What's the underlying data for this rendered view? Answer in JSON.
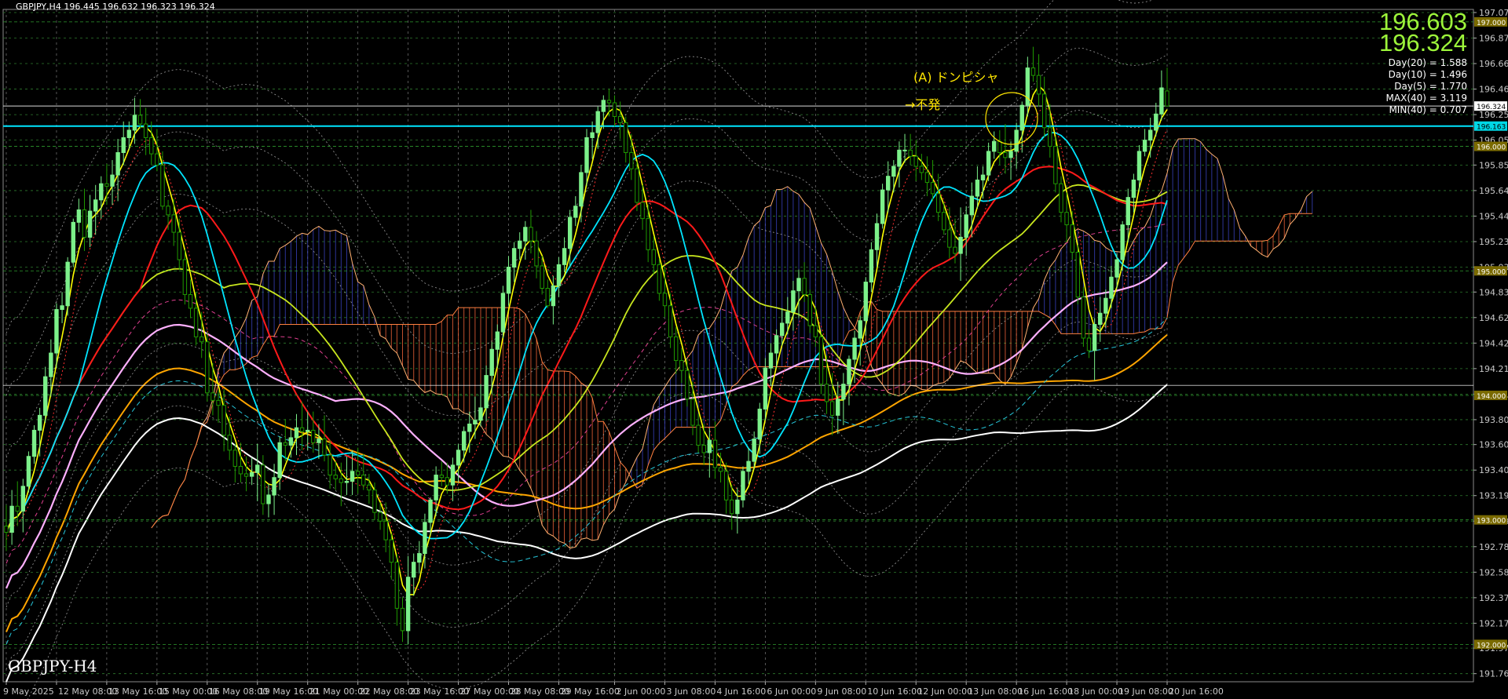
{
  "header": {
    "symbol_text": "GBPJPY,H4  196.445 196.632 196.323 196.324"
  },
  "watermark": "GBPJPY-H4",
  "quote": {
    "ask": "196.603",
    "bid": "196.324"
  },
  "stats": [
    "Day(20) = 1.588",
    "Day(10) = 1.496",
    "Day(5) = 1.770",
    "MAX(40) = 3.119",
    "MIN(40) = 0.707"
  ],
  "annotations": {
    "line1": "(A)  ドンピシャ",
    "line2": "→不発"
  },
  "price_tags": [
    {
      "price": 197.0,
      "text": "197.000",
      "bg": "#7a6a00",
      "fg": "#ffffff"
    },
    {
      "price": 196.324,
      "text": "196.324",
      "bg": "#ffffff",
      "fg": "#000000"
    },
    {
      "price": 196.163,
      "text": "196.163",
      "bg": "#00d7e6",
      "fg": "#000000"
    },
    {
      "price": 196.0,
      "text": "196.000",
      "bg": "#7a6a00",
      "fg": "#ffffff"
    },
    {
      "price": 195.0,
      "text": "195.000",
      "bg": "#7a6a00",
      "fg": "#ffffff"
    },
    {
      "price": 194.0,
      "text": "194.000",
      "bg": "#7a6a00",
      "fg": "#ffffff"
    },
    {
      "price": 193.0,
      "text": "193.000",
      "bg": "#7a6a00",
      "fg": "#ffffff"
    },
    {
      "price": 192.0,
      "text": "192.000",
      "bg": "#7a6a00",
      "fg": "#ffffff"
    }
  ],
  "colors": {
    "bull": "#7cf08a",
    "bear": "#1f9a00",
    "grid": "#2e7a2e",
    "sma_fast": "#ffff00",
    "sma_cyan": "#00e5ff",
    "sma_red": "#ff1a1a",
    "sma_olive": "#c8e61e",
    "sma_pink": "#ffb0ff",
    "sma_orange": "#ffa500",
    "sma_white": "#ffffff",
    "kumo_red": "#ff6a3d",
    "kumo_blue": "#3c46c8",
    "level_cyan": "#00e5ff",
    "level_white": "#d8d8d8"
  },
  "chart_data": {
    "type": "candlestick",
    "symbol": "GBPJPY",
    "timeframe": "H4",
    "ylim": [
      191.7,
      197.1
    ],
    "y_ticks": [
      "197.075",
      "196.870",
      "196.665",
      "196.460",
      "196.255",
      "196.050",
      "195.850",
      "195.645",
      "195.440",
      "195.235",
      "195.030",
      "194.830",
      "194.625",
      "194.420",
      "194.215",
      "194.010",
      "193.805",
      "193.605",
      "193.400",
      "193.195",
      "192.990",
      "192.785",
      "192.580",
      "192.375",
      "192.170",
      "191.970",
      "191.765"
    ],
    "x_labels": [
      "9 May 2025",
      "12 May 08:00",
      "13 May 16:00",
      "15 May 00:00",
      "16 May 08:00",
      "19 May 16:00",
      "21 May 00:00",
      "22 May 08:00",
      "23 May 16:00",
      "27 May 00:00",
      "28 May 08:00",
      "29 May 16:00",
      "2 Jun 00:00",
      "3 Jun 08:00",
      "4 Jun 16:00",
      "6 Jun 00:00",
      "9 Jun 08:00",
      "10 Jun 16:00",
      "12 Jun 00:00",
      "13 Jun 08:00",
      "16 Jun 16:00",
      "18 Jun 00:00",
      "19 Jun 08:00",
      "20 Jun 16:00"
    ],
    "last": {
      "open": 196.445,
      "high": 196.632,
      "low": 196.323,
      "close": 196.324
    },
    "levels": {
      "cyan_line": 196.163,
      "white_line": 196.324,
      "kumo_top_box": 194.08
    },
    "bar_count": 210,
    "candles": [
      [
        192.95,
        193.12,
        192.75,
        192.9
      ],
      [
        192.9,
        193.24,
        192.8,
        193.11
      ],
      [
        193.11,
        193.31,
        192.95,
        193.07
      ],
      [
        193.07,
        193.33,
        192.9,
        193.27
      ],
      [
        193.27,
        193.55,
        193.22,
        193.51
      ],
      [
        193.51,
        193.76,
        193.45,
        193.72
      ],
      [
        193.72,
        193.9,
        193.51,
        193.84
      ],
      [
        193.84,
        194.23,
        193.78,
        194.15
      ],
      [
        194.15,
        194.45,
        193.99,
        194.34
      ],
      [
        194.34,
        194.74,
        194.22,
        194.69
      ],
      [
        194.69,
        194.83,
        194.58,
        194.72
      ],
      [
        194.72,
        195.11,
        194.64,
        195.07
      ],
      [
        195.07,
        195.42,
        195.03,
        195.39
      ],
      [
        195.39,
        195.58,
        195.31,
        195.49
      ],
      [
        195.49,
        195.66,
        195.16,
        195.27
      ],
      [
        195.27,
        195.61,
        195.19,
        195.48
      ],
      [
        195.48,
        195.69,
        195.29,
        195.57
      ],
      [
        195.57,
        195.76,
        195.42,
        195.7
      ],
      [
        195.7,
        195.86,
        195.53,
        195.68
      ],
      [
        195.68,
        195.89,
        195.53,
        195.77
      ],
      [
        195.77,
        196.06,
        195.56,
        195.95
      ],
      [
        195.95,
        196.2,
        195.85,
        196.07
      ],
      [
        196.07,
        196.2,
        195.97,
        196.13
      ],
      [
        196.13,
        196.39,
        196.02,
        196.25
      ],
      [
        196.25,
        196.38,
        196.14,
        196.18
      ],
      [
        196.18,
        196.31,
        195.93,
        196.07
      ],
      [
        196.07,
        196.2,
        195.85,
        195.94
      ],
      [
        195.94,
        196.14,
        195.8,
        195.85
      ],
      [
        195.85,
        195.96,
        195.49,
        195.52
      ],
      [
        195.52,
        195.57,
        195.33,
        195.45
      ],
      [
        195.45,
        195.58,
        195.2,
        195.31
      ],
      [
        195.31,
        195.42,
        195.01,
        195.09
      ],
      [
        195.09,
        195.17,
        194.73,
        194.81
      ],
      [
        194.81,
        194.93,
        194.62,
        194.7
      ],
      [
        194.7,
        194.83,
        194.4,
        194.47
      ],
      [
        194.47,
        194.67,
        194.3,
        194.43
      ],
      [
        194.43,
        194.51,
        193.95,
        194.02
      ],
      [
        194.02,
        194.26,
        193.84,
        193.96
      ],
      [
        193.96,
        194.04,
        193.78,
        193.92
      ],
      [
        193.92,
        194.05,
        193.55,
        193.68
      ],
      [
        193.68,
        193.83,
        193.48,
        193.56
      ],
      [
        193.56,
        193.61,
        193.3,
        193.43
      ],
      [
        193.43,
        193.62,
        193.3,
        193.37
      ],
      [
        193.37,
        193.51,
        193.23,
        193.35
      ],
      [
        193.35,
        193.5,
        193.28,
        193.38
      ],
      [
        193.38,
        193.61,
        193.15,
        193.44
      ],
      [
        193.44,
        193.52,
        193.04,
        193.13
      ],
      [
        193.13,
        193.29,
        193.02,
        193.2
      ],
      [
        193.2,
        193.45,
        193.04,
        193.34
      ],
      [
        193.34,
        193.67,
        193.24,
        193.62
      ],
      [
        193.62,
        193.81,
        193.47,
        193.6
      ],
      [
        193.6,
        193.74,
        193.5,
        193.66
      ],
      [
        193.66,
        193.85,
        193.52,
        193.74
      ],
      [
        193.74,
        193.95,
        193.56,
        193.71
      ],
      [
        193.71,
        193.87,
        193.56,
        193.72
      ],
      [
        193.72,
        193.87,
        193.54,
        193.62
      ],
      [
        193.62,
        193.77,
        193.49,
        193.65
      ],
      [
        193.65,
        193.84,
        193.47,
        193.52
      ],
      [
        193.52,
        193.64,
        193.25,
        193.36
      ],
      [
        193.36,
        193.47,
        193.24,
        193.33
      ],
      [
        193.33,
        193.46,
        193.11,
        193.3
      ],
      [
        193.3,
        193.51,
        193.2,
        193.31
      ],
      [
        193.31,
        193.56,
        193.2,
        193.39
      ],
      [
        193.39,
        193.58,
        193.21,
        193.36
      ],
      [
        193.36,
        193.53,
        193.24,
        193.28
      ],
      [
        193.28,
        193.37,
        193.13,
        193.24
      ],
      [
        193.24,
        193.3,
        193.0,
        193.06
      ],
      [
        193.06,
        193.14,
        192.92,
        192.99
      ],
      [
        192.99,
        193.14,
        192.74,
        192.84
      ],
      [
        192.84,
        192.89,
        192.52,
        192.66
      ],
      [
        192.66,
        192.72,
        192.15,
        192.29
      ],
      [
        192.29,
        192.38,
        192.02,
        192.11
      ],
      [
        192.11,
        192.71,
        192.0,
        192.54
      ],
      [
        192.54,
        192.73,
        192.39,
        192.66
      ],
      [
        192.66,
        192.83,
        192.57,
        192.73
      ],
      [
        192.73,
        193.05,
        192.61,
        192.98
      ],
      [
        192.98,
        193.18,
        192.88,
        193.16
      ],
      [
        193.16,
        193.43,
        193.03,
        193.36
      ],
      [
        193.36,
        193.47,
        193.27,
        193.34
      ],
      [
        193.34,
        193.46,
        193.21,
        193.28
      ],
      [
        193.28,
        193.5,
        193.15,
        193.44
      ],
      [
        193.44,
        193.61,
        193.3,
        193.56
      ],
      [
        193.56,
        193.75,
        193.46,
        193.71
      ],
      [
        193.71,
        193.87,
        193.54,
        193.77
      ],
      [
        193.77,
        193.99,
        193.65,
        193.8
      ],
      [
        193.8,
        194.09,
        193.75,
        193.9
      ],
      [
        193.9,
        194.24,
        193.79,
        194.16
      ],
      [
        194.16,
        194.43,
        194.01,
        194.37
      ],
      [
        194.37,
        194.57,
        194.22,
        194.51
      ],
      [
        194.51,
        194.88,
        194.46,
        194.82
      ],
      [
        194.82,
        195.12,
        194.72,
        195.03
      ],
      [
        195.03,
        195.23,
        194.91,
        195.18
      ],
      [
        195.18,
        195.31,
        195.09,
        195.24
      ],
      [
        195.24,
        195.4,
        195.09,
        195.35
      ],
      [
        195.35,
        195.49,
        195.14,
        195.24
      ],
      [
        195.24,
        195.32,
        194.94,
        195.04
      ],
      [
        195.04,
        195.12,
        194.81,
        194.86
      ],
      [
        194.86,
        194.93,
        194.7,
        194.72
      ],
      [
        194.72,
        194.96,
        194.57,
        194.88
      ],
      [
        194.88,
        195.11,
        194.79,
        195.05
      ],
      [
        195.05,
        195.27,
        194.99,
        195.18
      ],
      [
        195.18,
        195.49,
        195.04,
        195.43
      ],
      [
        195.43,
        195.6,
        195.36,
        195.52
      ],
      [
        195.52,
        195.85,
        195.39,
        195.79
      ],
      [
        195.79,
        196.14,
        195.68,
        196.07
      ],
      [
        196.07,
        196.2,
        195.9,
        196.11
      ],
      [
        196.11,
        196.32,
        195.98,
        196.28
      ],
      [
        196.28,
        196.41,
        196.14,
        196.37
      ],
      [
        196.37,
        196.46,
        196.24,
        196.35
      ],
      [
        196.35,
        196.41,
        196.16,
        196.24
      ],
      [
        196.24,
        196.36,
        196.06,
        196.19
      ],
      [
        196.19,
        196.24,
        195.87,
        195.95
      ],
      [
        195.95,
        196.1,
        195.73,
        195.82
      ],
      [
        195.82,
        195.88,
        195.48,
        195.55
      ],
      [
        195.55,
        195.69,
        195.33,
        195.42
      ],
      [
        195.42,
        195.53,
        195.07,
        195.17
      ],
      [
        195.17,
        195.28,
        194.97,
        195.05
      ],
      [
        195.05,
        195.1,
        194.76,
        194.82
      ],
      [
        194.82,
        195.03,
        194.63,
        194.72
      ],
      [
        194.72,
        194.82,
        194.38,
        194.47
      ],
      [
        194.47,
        194.55,
        194.17,
        194.28
      ],
      [
        194.28,
        194.38,
        194.1,
        194.2
      ],
      [
        194.2,
        194.29,
        193.91,
        193.97
      ],
      [
        193.97,
        194.11,
        193.68,
        193.76
      ],
      [
        193.76,
        193.85,
        193.54,
        193.6
      ],
      [
        193.6,
        193.77,
        193.44,
        193.54
      ],
      [
        193.54,
        193.74,
        193.34,
        193.64
      ],
      [
        193.64,
        193.79,
        193.33,
        193.42
      ],
      [
        193.42,
        193.54,
        193.3,
        193.39
      ],
      [
        193.39,
        193.46,
        193.05,
        193.16
      ],
      [
        193.16,
        193.28,
        192.92,
        193.05
      ],
      [
        193.05,
        193.26,
        192.89,
        193.16
      ],
      [
        193.16,
        193.43,
        193.1,
        193.39
      ],
      [
        193.39,
        193.58,
        193.29,
        193.47
      ],
      [
        193.47,
        193.71,
        193.41,
        193.65
      ],
      [
        193.65,
        193.94,
        193.53,
        193.89
      ],
      [
        193.89,
        194.3,
        193.8,
        194.22
      ],
      [
        194.22,
        194.42,
        194.08,
        194.34
      ],
      [
        194.34,
        194.53,
        194.22,
        194.48
      ],
      [
        194.48,
        194.7,
        194.4,
        194.58
      ],
      [
        194.58,
        194.79,
        194.49,
        194.67
      ],
      [
        194.67,
        194.92,
        194.52,
        194.84
      ],
      [
        194.84,
        195.01,
        194.62,
        194.94
      ],
      [
        194.94,
        195.07,
        194.75,
        194.81
      ],
      [
        194.81,
        194.85,
        194.5,
        194.56
      ],
      [
        194.56,
        194.71,
        194.39,
        194.47
      ],
      [
        194.47,
        194.51,
        194.01,
        194.09
      ],
      [
        194.09,
        194.32,
        193.85,
        193.95
      ],
      [
        193.95,
        194.18,
        193.68,
        193.84
      ],
      [
        193.84,
        194.11,
        193.69,
        193.97
      ],
      [
        193.97,
        194.18,
        193.76,
        194.09
      ],
      [
        194.09,
        194.32,
        193.92,
        194.29
      ],
      [
        194.29,
        194.52,
        194.1,
        194.46
      ],
      [
        194.46,
        194.64,
        194.24,
        194.6
      ],
      [
        194.6,
        194.95,
        194.48,
        194.91
      ],
      [
        194.91,
        195.23,
        194.83,
        195.17
      ],
      [
        195.17,
        195.46,
        195.03,
        195.38
      ],
      [
        195.38,
        195.7,
        195.34,
        195.65
      ],
      [
        195.65,
        195.88,
        195.47,
        195.76
      ],
      [
        195.76,
        195.89,
        195.63,
        195.84
      ],
      [
        195.84,
        196.04,
        195.67,
        195.97
      ],
      [
        195.97,
        196.1,
        195.87,
        195.97
      ],
      [
        195.97,
        196.1,
        195.85,
        195.92
      ],
      [
        195.92,
        196.05,
        195.72,
        195.84
      ],
      [
        195.84,
        195.94,
        195.73,
        195.79
      ],
      [
        195.79,
        195.92,
        195.6,
        195.71
      ],
      [
        195.71,
        195.89,
        195.56,
        195.62
      ],
      [
        195.62,
        195.78,
        195.4,
        195.47
      ],
      [
        195.47,
        195.55,
        195.29,
        195.33
      ],
      [
        195.33,
        195.51,
        195.1,
        195.19
      ],
      [
        195.19,
        195.42,
        195.06,
        195.14
      ],
      [
        195.14,
        195.51,
        194.92,
        195.27
      ],
      [
        195.27,
        195.52,
        195.12,
        195.45
      ],
      [
        195.45,
        195.71,
        195.27,
        195.6
      ],
      [
        195.6,
        195.84,
        195.5,
        195.73
      ],
      [
        195.73,
        195.84,
        195.58,
        195.77
      ],
      [
        195.77,
        196.03,
        195.72,
        195.96
      ],
      [
        195.96,
        196.12,
        195.9,
        196.04
      ],
      [
        196.04,
        196.13,
        195.85,
        195.95
      ],
      [
        195.95,
        196.18,
        195.78,
        195.91
      ],
      [
        195.91,
        196.04,
        195.73,
        195.96
      ],
      [
        195.96,
        196.19,
        195.82,
        196.13
      ],
      [
        196.13,
        196.36,
        195.95,
        196.33
      ],
      [
        196.33,
        196.72,
        196.24,
        196.63
      ],
      [
        196.63,
        196.8,
        196.52,
        196.57
      ],
      [
        196.57,
        196.74,
        196.32,
        196.42
      ],
      [
        196.42,
        196.56,
        196.07,
        196.15
      ],
      [
        196.15,
        196.34,
        195.91,
        196.0
      ],
      [
        196.0,
        196.08,
        195.63,
        195.7
      ],
      [
        195.7,
        195.76,
        195.39,
        195.47
      ],
      [
        195.47,
        195.63,
        195.23,
        195.37
      ],
      [
        195.37,
        195.48,
        195.09,
        195.15
      ],
      [
        195.15,
        195.21,
        194.73,
        194.79
      ],
      [
        194.79,
        194.87,
        194.39,
        194.46
      ],
      [
        194.46,
        194.53,
        194.3,
        194.36
      ],
      [
        194.36,
        194.62,
        194.12,
        194.57
      ],
      [
        194.57,
        194.79,
        194.43,
        194.66
      ],
      [
        194.66,
        194.85,
        194.54,
        194.78
      ],
      [
        194.78,
        195.04,
        194.7,
        194.95
      ],
      [
        194.95,
        195.14,
        194.86,
        195.09
      ],
      [
        195.09,
        195.4,
        195.0,
        195.37
      ],
      [
        195.37,
        195.66,
        195.23,
        195.59
      ],
      [
        195.59,
        195.78,
        195.47,
        195.73
      ],
      [
        195.73,
        196.01,
        195.64,
        195.96
      ],
      [
        195.96,
        196.14,
        195.92,
        196.05
      ],
      [
        196.05,
        196.23,
        195.91,
        196.13
      ],
      [
        196.13,
        196.35,
        196.08,
        196.26
      ],
      [
        196.26,
        196.61,
        196.21,
        196.47
      ],
      [
        196.445,
        196.632,
        196.323,
        196.324
      ]
    ]
  }
}
